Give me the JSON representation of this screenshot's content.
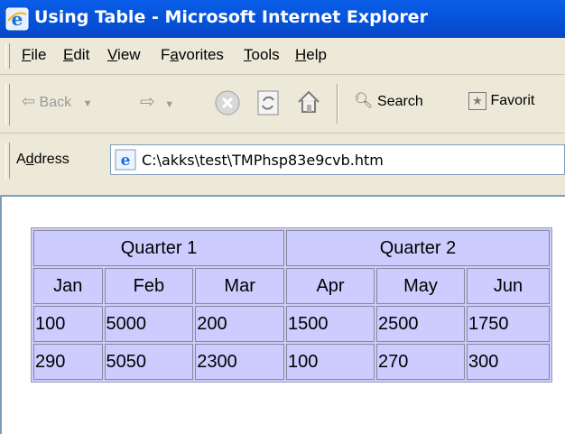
{
  "window": {
    "title": "Using Table - Microsoft Internet Explorer"
  },
  "menu": [
    {
      "label": "File",
      "key": "F"
    },
    {
      "label": "Edit",
      "key": "E"
    },
    {
      "label": "View",
      "key": "V"
    },
    {
      "label": "Favorites",
      "key": "a"
    },
    {
      "label": "Tools",
      "key": "T"
    },
    {
      "label": "Help",
      "key": "H"
    }
  ],
  "toolbar": {
    "back": "Back",
    "search": "Search",
    "favorites": "Favorit"
  },
  "address": {
    "label": "Address",
    "value": "C:\\akks\\test\\TMPhsp83e9cvb.htm"
  },
  "table": {
    "groups": [
      "Quarter 1",
      "Quarter 2"
    ],
    "months": [
      "Jan",
      "Feb",
      "Mar",
      "Apr",
      "May",
      "Jun"
    ],
    "rows": [
      [
        "100",
        "5000",
        "200",
        "1500",
        "2500",
        "1750"
      ],
      [
        "290",
        "5050",
        "2300",
        "100",
        "270",
        "300"
      ]
    ]
  }
}
